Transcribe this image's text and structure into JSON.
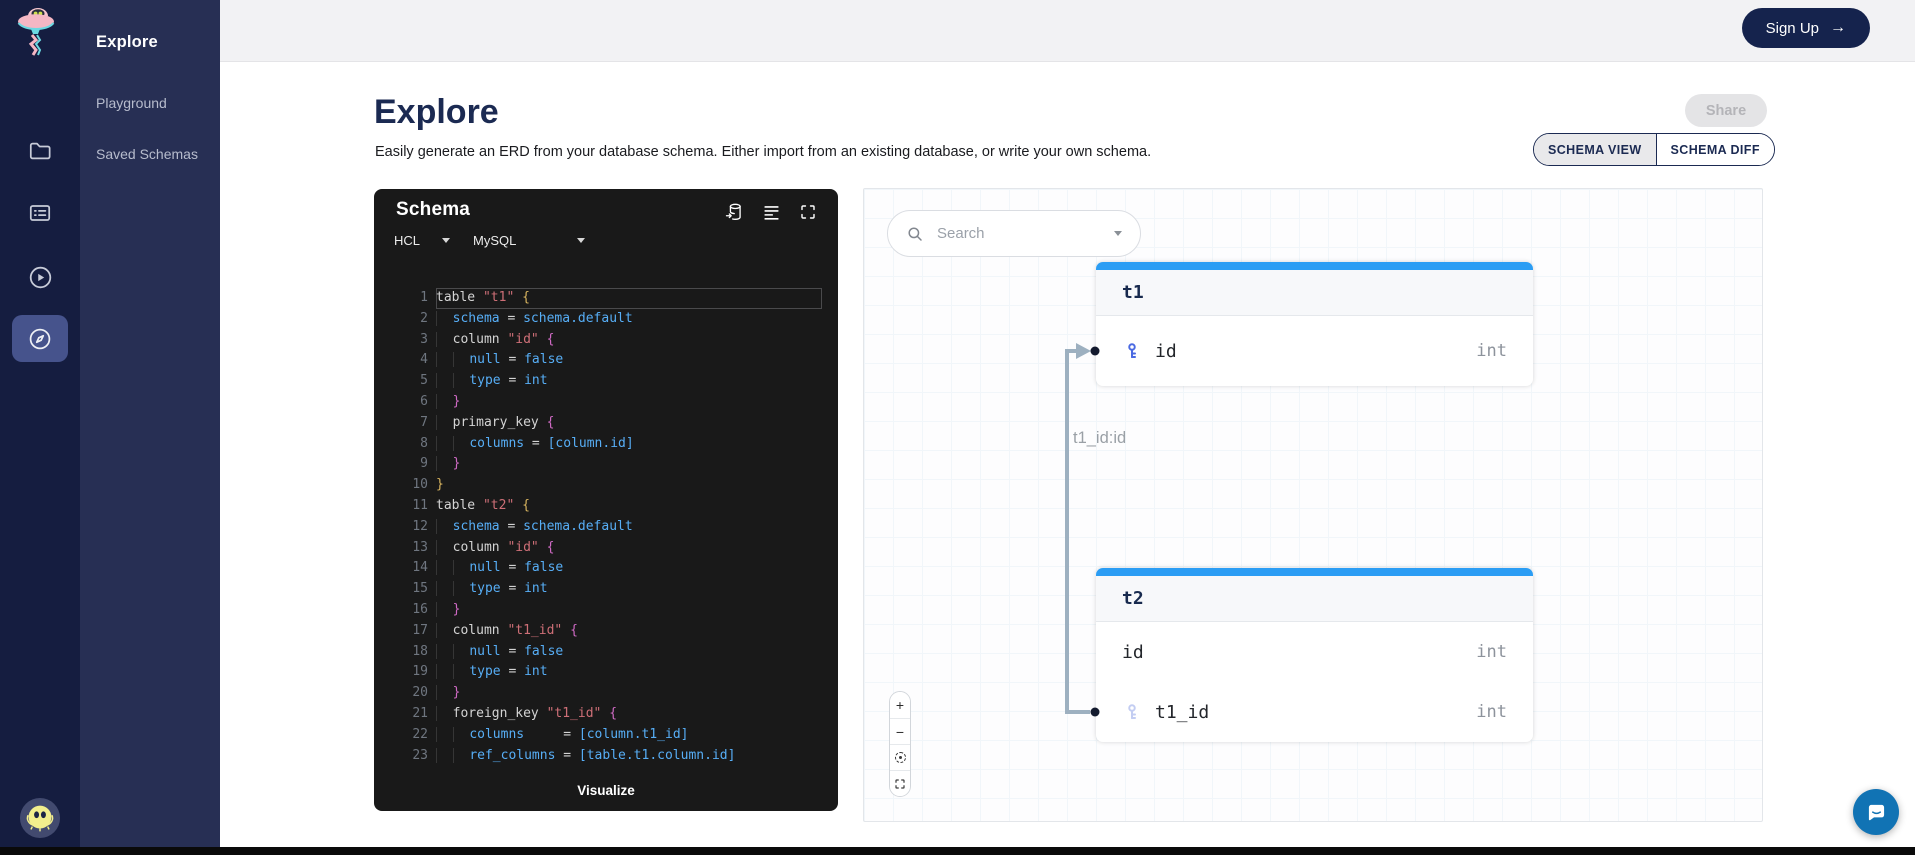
{
  "sidebar": {
    "heading": "Explore",
    "items": [
      {
        "label": "Playground"
      },
      {
        "label": "Saved Schemas"
      }
    ]
  },
  "topbar": {
    "sign_up_label": "Sign Up",
    "sign_up_arrow": "→"
  },
  "page": {
    "title": "Explore",
    "subtitle": "Easily generate an ERD from your database schema. Either import from an existing database, or write your own schema.",
    "share_label": "Share",
    "view_tabs": [
      {
        "label": "SCHEMA VIEW",
        "active": true
      },
      {
        "label": "SCHEMA DIFF",
        "active": false
      }
    ]
  },
  "editor": {
    "title": "Schema",
    "language_select": {
      "value": "HCL"
    },
    "dialect_select": {
      "value": "MySQL"
    },
    "visualize_label": "Visualize",
    "code_lines": [
      {
        "n": 1,
        "ind": 0,
        "active": true,
        "t": [
          [
            "kw",
            "table "
          ],
          [
            "str",
            "\"t1\""
          ],
          [
            "kw",
            " "
          ],
          [
            "b1",
            "{"
          ]
        ]
      },
      {
        "n": 2,
        "ind": 1,
        "t": [
          [
            "id",
            "schema"
          ],
          [
            "kw",
            " = "
          ],
          [
            "id",
            "schema.default"
          ]
        ]
      },
      {
        "n": 3,
        "ind": 1,
        "t": [
          [
            "kw",
            "column "
          ],
          [
            "str",
            "\"id\""
          ],
          [
            "kw",
            " "
          ],
          [
            "b2",
            "{"
          ]
        ]
      },
      {
        "n": 4,
        "ind": 2,
        "t": [
          [
            "id",
            "null"
          ],
          [
            "kw",
            " = "
          ],
          [
            "id",
            "false"
          ]
        ]
      },
      {
        "n": 5,
        "ind": 2,
        "t": [
          [
            "id",
            "type"
          ],
          [
            "kw",
            " = "
          ],
          [
            "id",
            "int"
          ]
        ]
      },
      {
        "n": 6,
        "ind": 1,
        "t": [
          [
            "b2",
            "}"
          ]
        ]
      },
      {
        "n": 7,
        "ind": 1,
        "t": [
          [
            "kw",
            "primary_key "
          ],
          [
            "b2",
            "{"
          ]
        ]
      },
      {
        "n": 8,
        "ind": 2,
        "t": [
          [
            "id",
            "columns"
          ],
          [
            "kw",
            " = "
          ],
          [
            "id",
            "[column.id]"
          ]
        ]
      },
      {
        "n": 9,
        "ind": 1,
        "t": [
          [
            "b2",
            "}"
          ]
        ]
      },
      {
        "n": 10,
        "ind": 0,
        "t": [
          [
            "b1",
            "}"
          ]
        ]
      },
      {
        "n": 11,
        "ind": 0,
        "t": [
          [
            "kw",
            "table "
          ],
          [
            "str",
            "\"t2\""
          ],
          [
            "kw",
            " "
          ],
          [
            "b1",
            "{"
          ]
        ]
      },
      {
        "n": 12,
        "ind": 1,
        "t": [
          [
            "id",
            "schema"
          ],
          [
            "kw",
            " = "
          ],
          [
            "id",
            "schema.default"
          ]
        ]
      },
      {
        "n": 13,
        "ind": 1,
        "t": [
          [
            "kw",
            "column "
          ],
          [
            "str",
            "\"id\""
          ],
          [
            "kw",
            " "
          ],
          [
            "b2",
            "{"
          ]
        ]
      },
      {
        "n": 14,
        "ind": 2,
        "t": [
          [
            "id",
            "null"
          ],
          [
            "kw",
            " = "
          ],
          [
            "id",
            "false"
          ]
        ]
      },
      {
        "n": 15,
        "ind": 2,
        "t": [
          [
            "id",
            "type"
          ],
          [
            "kw",
            " = "
          ],
          [
            "id",
            "int"
          ]
        ]
      },
      {
        "n": 16,
        "ind": 1,
        "t": [
          [
            "b2",
            "}"
          ]
        ]
      },
      {
        "n": 17,
        "ind": 1,
        "t": [
          [
            "kw",
            "column "
          ],
          [
            "str",
            "\"t1_id\""
          ],
          [
            "kw",
            " "
          ],
          [
            "b2",
            "{"
          ]
        ]
      },
      {
        "n": 18,
        "ind": 2,
        "t": [
          [
            "id",
            "null"
          ],
          [
            "kw",
            " = "
          ],
          [
            "id",
            "false"
          ]
        ]
      },
      {
        "n": 19,
        "ind": 2,
        "t": [
          [
            "id",
            "type"
          ],
          [
            "kw",
            " = "
          ],
          [
            "id",
            "int"
          ]
        ]
      },
      {
        "n": 20,
        "ind": 1,
        "t": [
          [
            "b2",
            "}"
          ]
        ]
      },
      {
        "n": 21,
        "ind": 1,
        "t": [
          [
            "kw",
            "foreign_key "
          ],
          [
            "str",
            "\"t1_id\""
          ],
          [
            "kw",
            " "
          ],
          [
            "b2",
            "{"
          ]
        ]
      },
      {
        "n": 22,
        "ind": 2,
        "t": [
          [
            "id",
            "columns"
          ],
          [
            "kw",
            "     = "
          ],
          [
            "id",
            "[column.t1_id]"
          ]
        ]
      },
      {
        "n": 23,
        "ind": 2,
        "t": [
          [
            "id",
            "ref_columns"
          ],
          [
            "kw",
            " = "
          ],
          [
            "id",
            "[table.t1.column.id]"
          ]
        ]
      }
    ]
  },
  "canvas": {
    "search_placeholder": "Search",
    "edge_label": "t1_id:id",
    "tables": [
      {
        "name": "t1",
        "columns": [
          {
            "name": "id",
            "type": "int",
            "key": "primary",
            "handle": true
          }
        ]
      },
      {
        "name": "t2",
        "columns": [
          {
            "name": "id",
            "type": "int",
            "key": null,
            "handle": false
          },
          {
            "name": "t1_id",
            "type": "int",
            "key": "foreign",
            "handle": true
          }
        ]
      }
    ],
    "zoom_controls": {
      "zoom_in": "+",
      "zoom_out": "−"
    }
  },
  "colors": {
    "accent_blue": "#2b9df4",
    "primary_key_icon": "#4b6ae2",
    "foreign_key_icon": "#c3cdf2",
    "edge": "#9db0c0",
    "navy": "#1b2a52",
    "sidebar_bg": "#151d40",
    "subnav_bg": "#272f54",
    "chat_bubble": "#1173b4"
  }
}
